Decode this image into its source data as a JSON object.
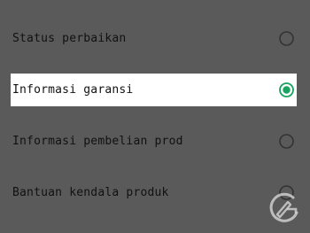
{
  "options": [
    {
      "label": "Status perbaikan",
      "selected": false
    },
    {
      "label": "Informasi garansi",
      "selected": true
    },
    {
      "label": "Informasi pembelian prod",
      "selected": false
    },
    {
      "label": "Bantuan kendala produk",
      "selected": false
    }
  ],
  "colors": {
    "background": "#5a5a5a",
    "selected_row": "#ffffff",
    "accent": "#1aa260",
    "radio_unselected": "#333333",
    "text": "#111111"
  },
  "icons": {
    "radio_selected": "radio-selected-icon",
    "radio_unselected": "radio-unselected-icon",
    "watermark": "gadget-logo-watermark"
  }
}
